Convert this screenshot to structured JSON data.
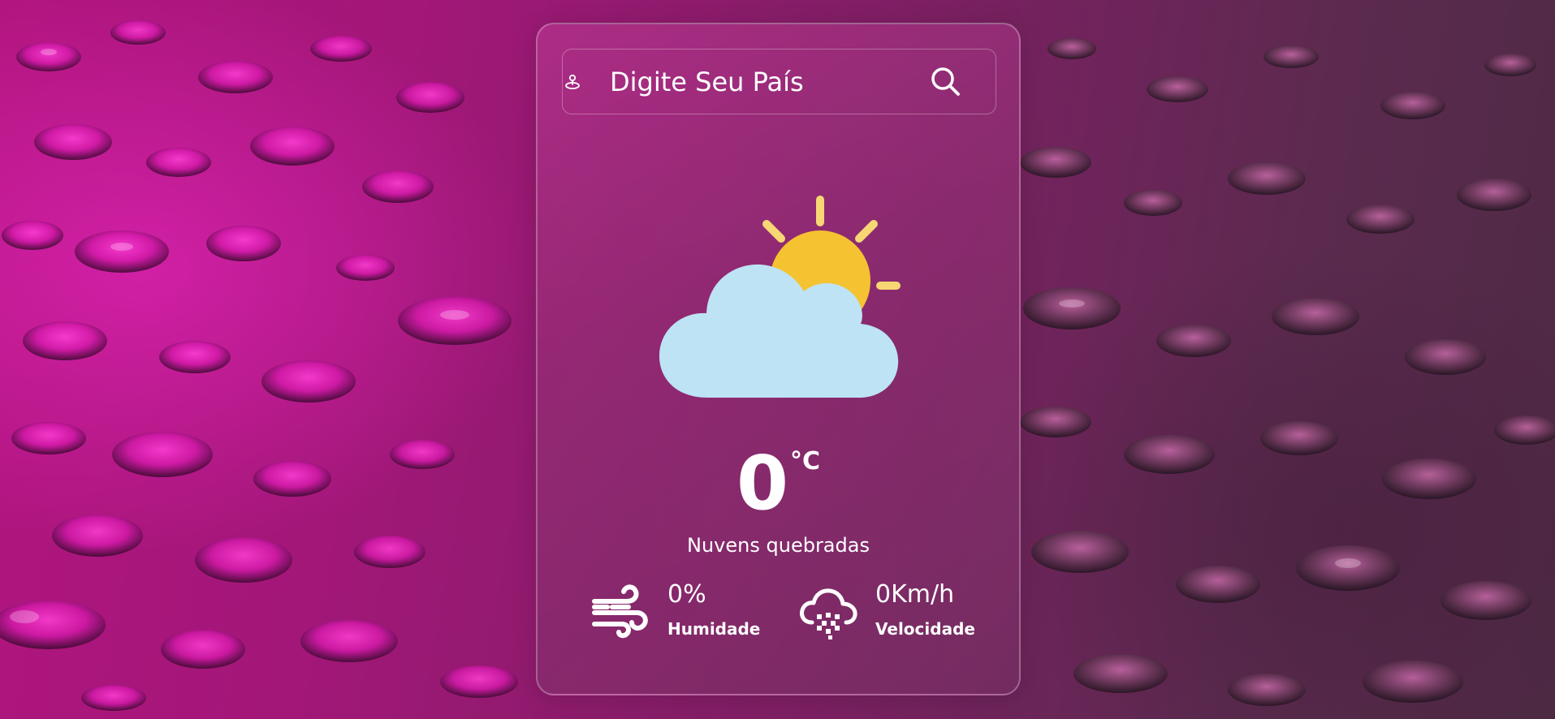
{
  "search": {
    "placeholder": "Digite Seu País"
  },
  "weather": {
    "icon": "partly-cloudy-icon",
    "temperature": "0",
    "unit": "°C",
    "description": "Nuvens quebradas"
  },
  "details": {
    "humidity": {
      "value": "0%",
      "label": "Humidade",
      "icon": "wind-icon"
    },
    "wind": {
      "value": "0Km/h",
      "label": "Velocidade",
      "icon": "cloud-rain-icon"
    }
  },
  "colors": {
    "background_accent": "#b2157f",
    "sun": "#f5c231",
    "cloud": "#bde3f4",
    "sun_rays": "#f7d774",
    "text": "#ffffff"
  }
}
